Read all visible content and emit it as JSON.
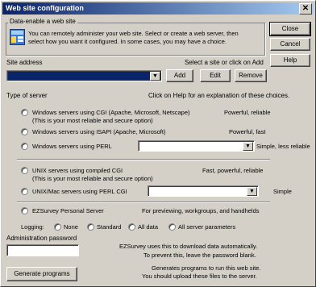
{
  "window": {
    "title": "Web site configuration",
    "close_glyph": "✕"
  },
  "side_buttons": {
    "close": "Close",
    "cancel": "Cancel",
    "help": "Help"
  },
  "data_enable": {
    "group_label": "Data-enable a web site",
    "line1": "You can remotely administer  your web site. Select or create a web server, then",
    "line2": "select how you want it configured. In some cases, you may have a choice."
  },
  "site": {
    "label": "Site address",
    "hint": "Select a site or click on Add",
    "add": "Add",
    "edit": "Edit",
    "remove": "Remove"
  },
  "server": {
    "label": "Type of server",
    "hint": "Click on Help for an explanation of these choices.",
    "options": [
      {
        "label": "Windows servers using CGI (Apache, Microsoft, Netscape)",
        "note": "(This is your most reliable and secure option)",
        "desc": "Powerful, reliable"
      },
      {
        "label": "Windows servers using ISAPI (Apache, Microsoft)",
        "desc": "Powerful, fast"
      },
      {
        "label": "Windows servers using PERL",
        "desc": "Simple, less reliable"
      },
      {
        "label": "UNIX servers using compiled CGI",
        "note": "(This is your most reliable and secure option)",
        "desc": "Fast, powerful, reliable"
      },
      {
        "label": "UNIX/Mac servers using PERL CGI",
        "desc": "Simple"
      },
      {
        "label": "EZSurvey Personal Server",
        "desc": "For previewing, workgroups, and handhelds"
      }
    ]
  },
  "logging": {
    "label": "Logging:",
    "options": [
      "None",
      "Standard",
      "All data",
      "All server parameters"
    ]
  },
  "admin": {
    "label": "Administration password",
    "info1": "EZSurvey uses this to download data automatically.",
    "info2": "To prevent this, leave the password blank."
  },
  "generate": {
    "button": "Generate programs",
    "info1": "Generates programs to run this web site.",
    "info2": "You should upload these files to the server."
  },
  "colors": {
    "selection": "#0a246a",
    "face": "#d4d0c8"
  }
}
